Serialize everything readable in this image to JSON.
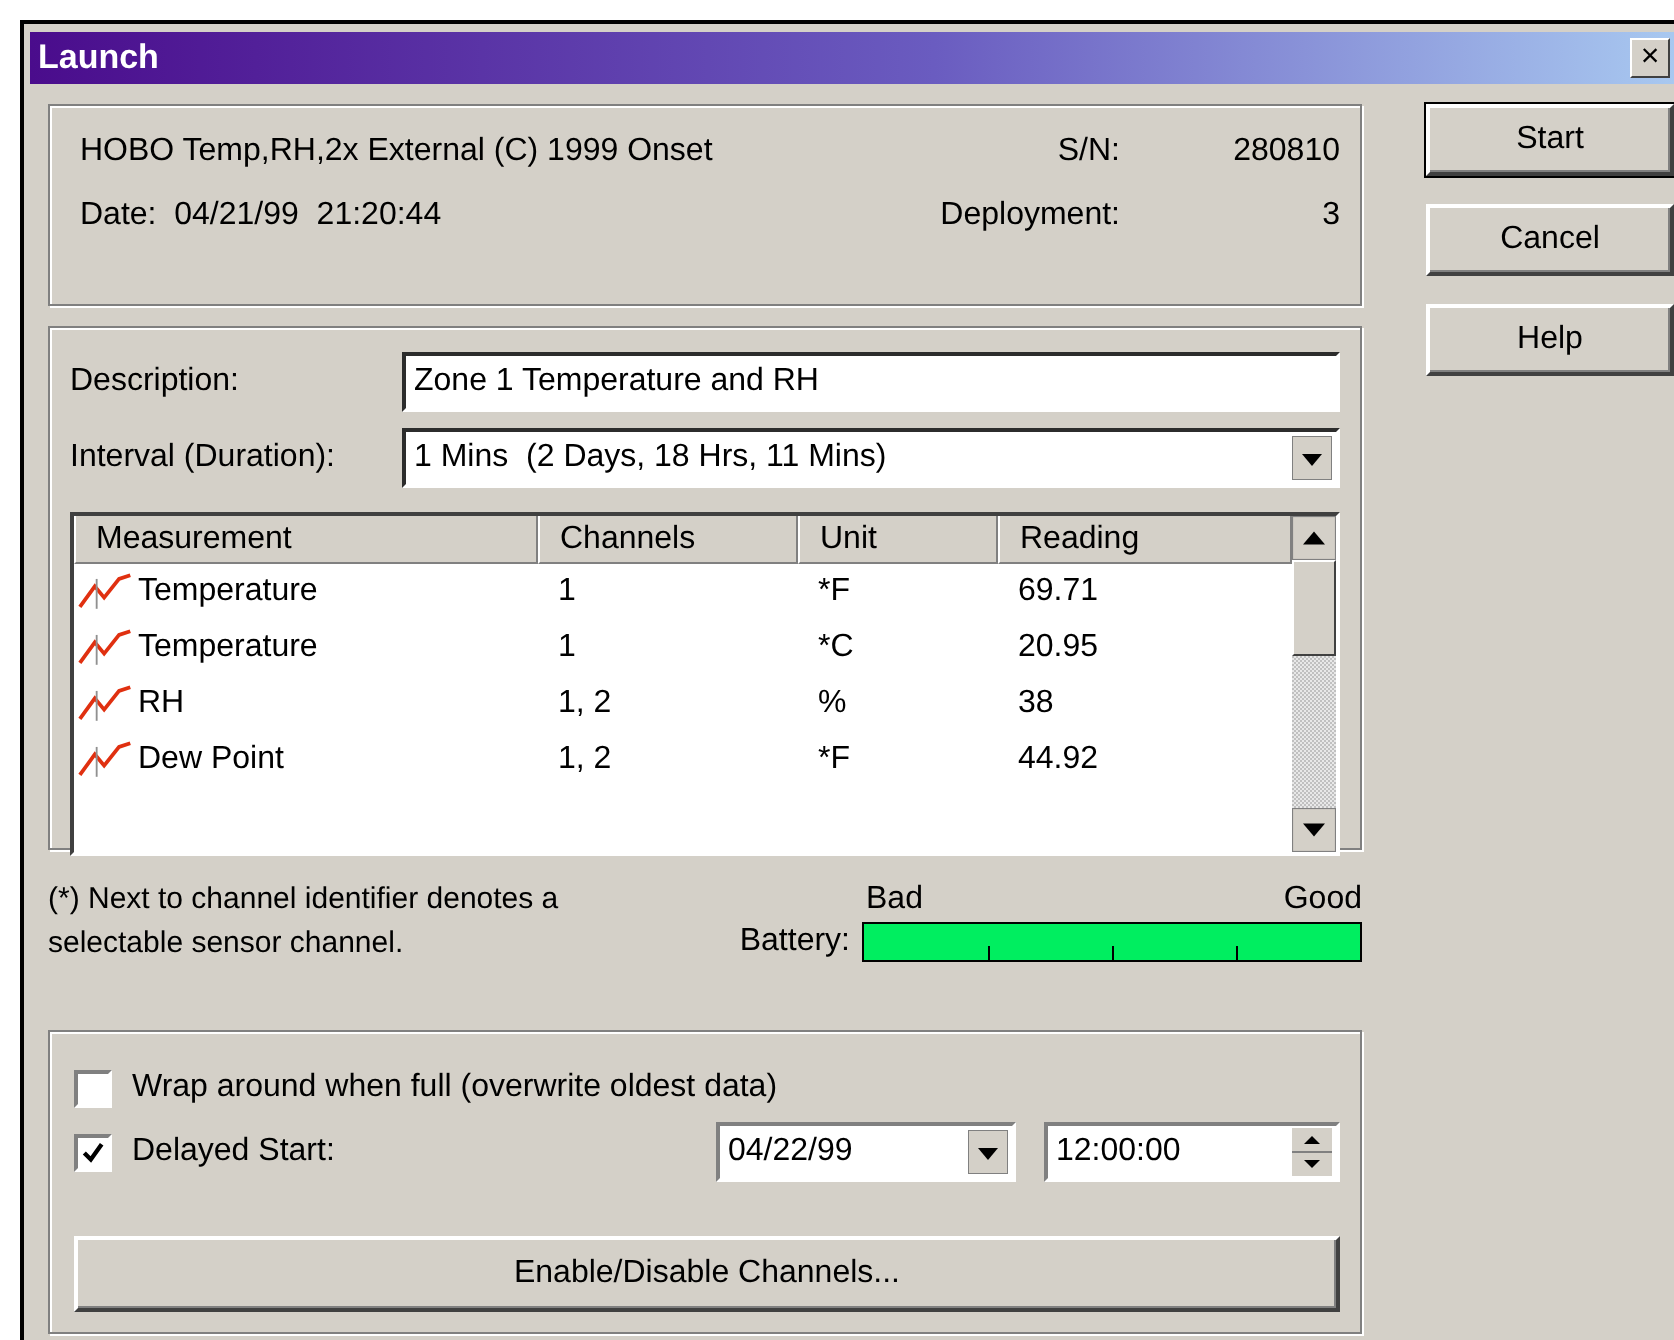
{
  "window": {
    "title": "Launch",
    "close": "×"
  },
  "logger": {
    "model": "HOBO Temp,RH,2x External (C) 1999 Onset",
    "sn_label": "S/N:",
    "sn": "280810",
    "date": "Date:  04/21/99  21:20:44",
    "deployment_label": "Deployment:",
    "deployment": "3"
  },
  "description": {
    "label": "Description:",
    "value": "Zone 1 Temperature and RH"
  },
  "interval": {
    "label": "Interval (Duration):",
    "value": "1 Mins  (2 Days, 18 Hrs, 11 Mins)"
  },
  "table": {
    "columns": [
      "Measurement",
      "Channels",
      "Unit",
      "Reading"
    ],
    "rows": [
      {
        "measurement": "Temperature",
        "channels": "1",
        "unit": "*F",
        "reading": "69.71"
      },
      {
        "measurement": "Temperature",
        "channels": "1",
        "unit": "*C",
        "reading": "20.95"
      },
      {
        "measurement": "RH",
        "channels": "1, 2",
        "unit": "%",
        "reading": "38"
      },
      {
        "measurement": "Dew Point",
        "channels": "1, 2",
        "unit": "*F",
        "reading": "44.92"
      }
    ]
  },
  "note": "(*) Next to channel identifier denotes a selectable sensor channel.",
  "battery": {
    "label": "Battery:",
    "low_label": "Bad",
    "high_label": "Good",
    "level": 1
  },
  "options": [
    {
      "label": "Wrap around when full (overwrite oldest data)",
      "checked": false
    },
    {
      "label": "Delayed Start:",
      "checked": true
    }
  ],
  "delayed_start": {
    "date": "04/22/99",
    "time": "12:00:00"
  },
  "channels_button": "Enable/Disable Channels...",
  "buttons": [
    "Start",
    "Cancel",
    "Help"
  ]
}
